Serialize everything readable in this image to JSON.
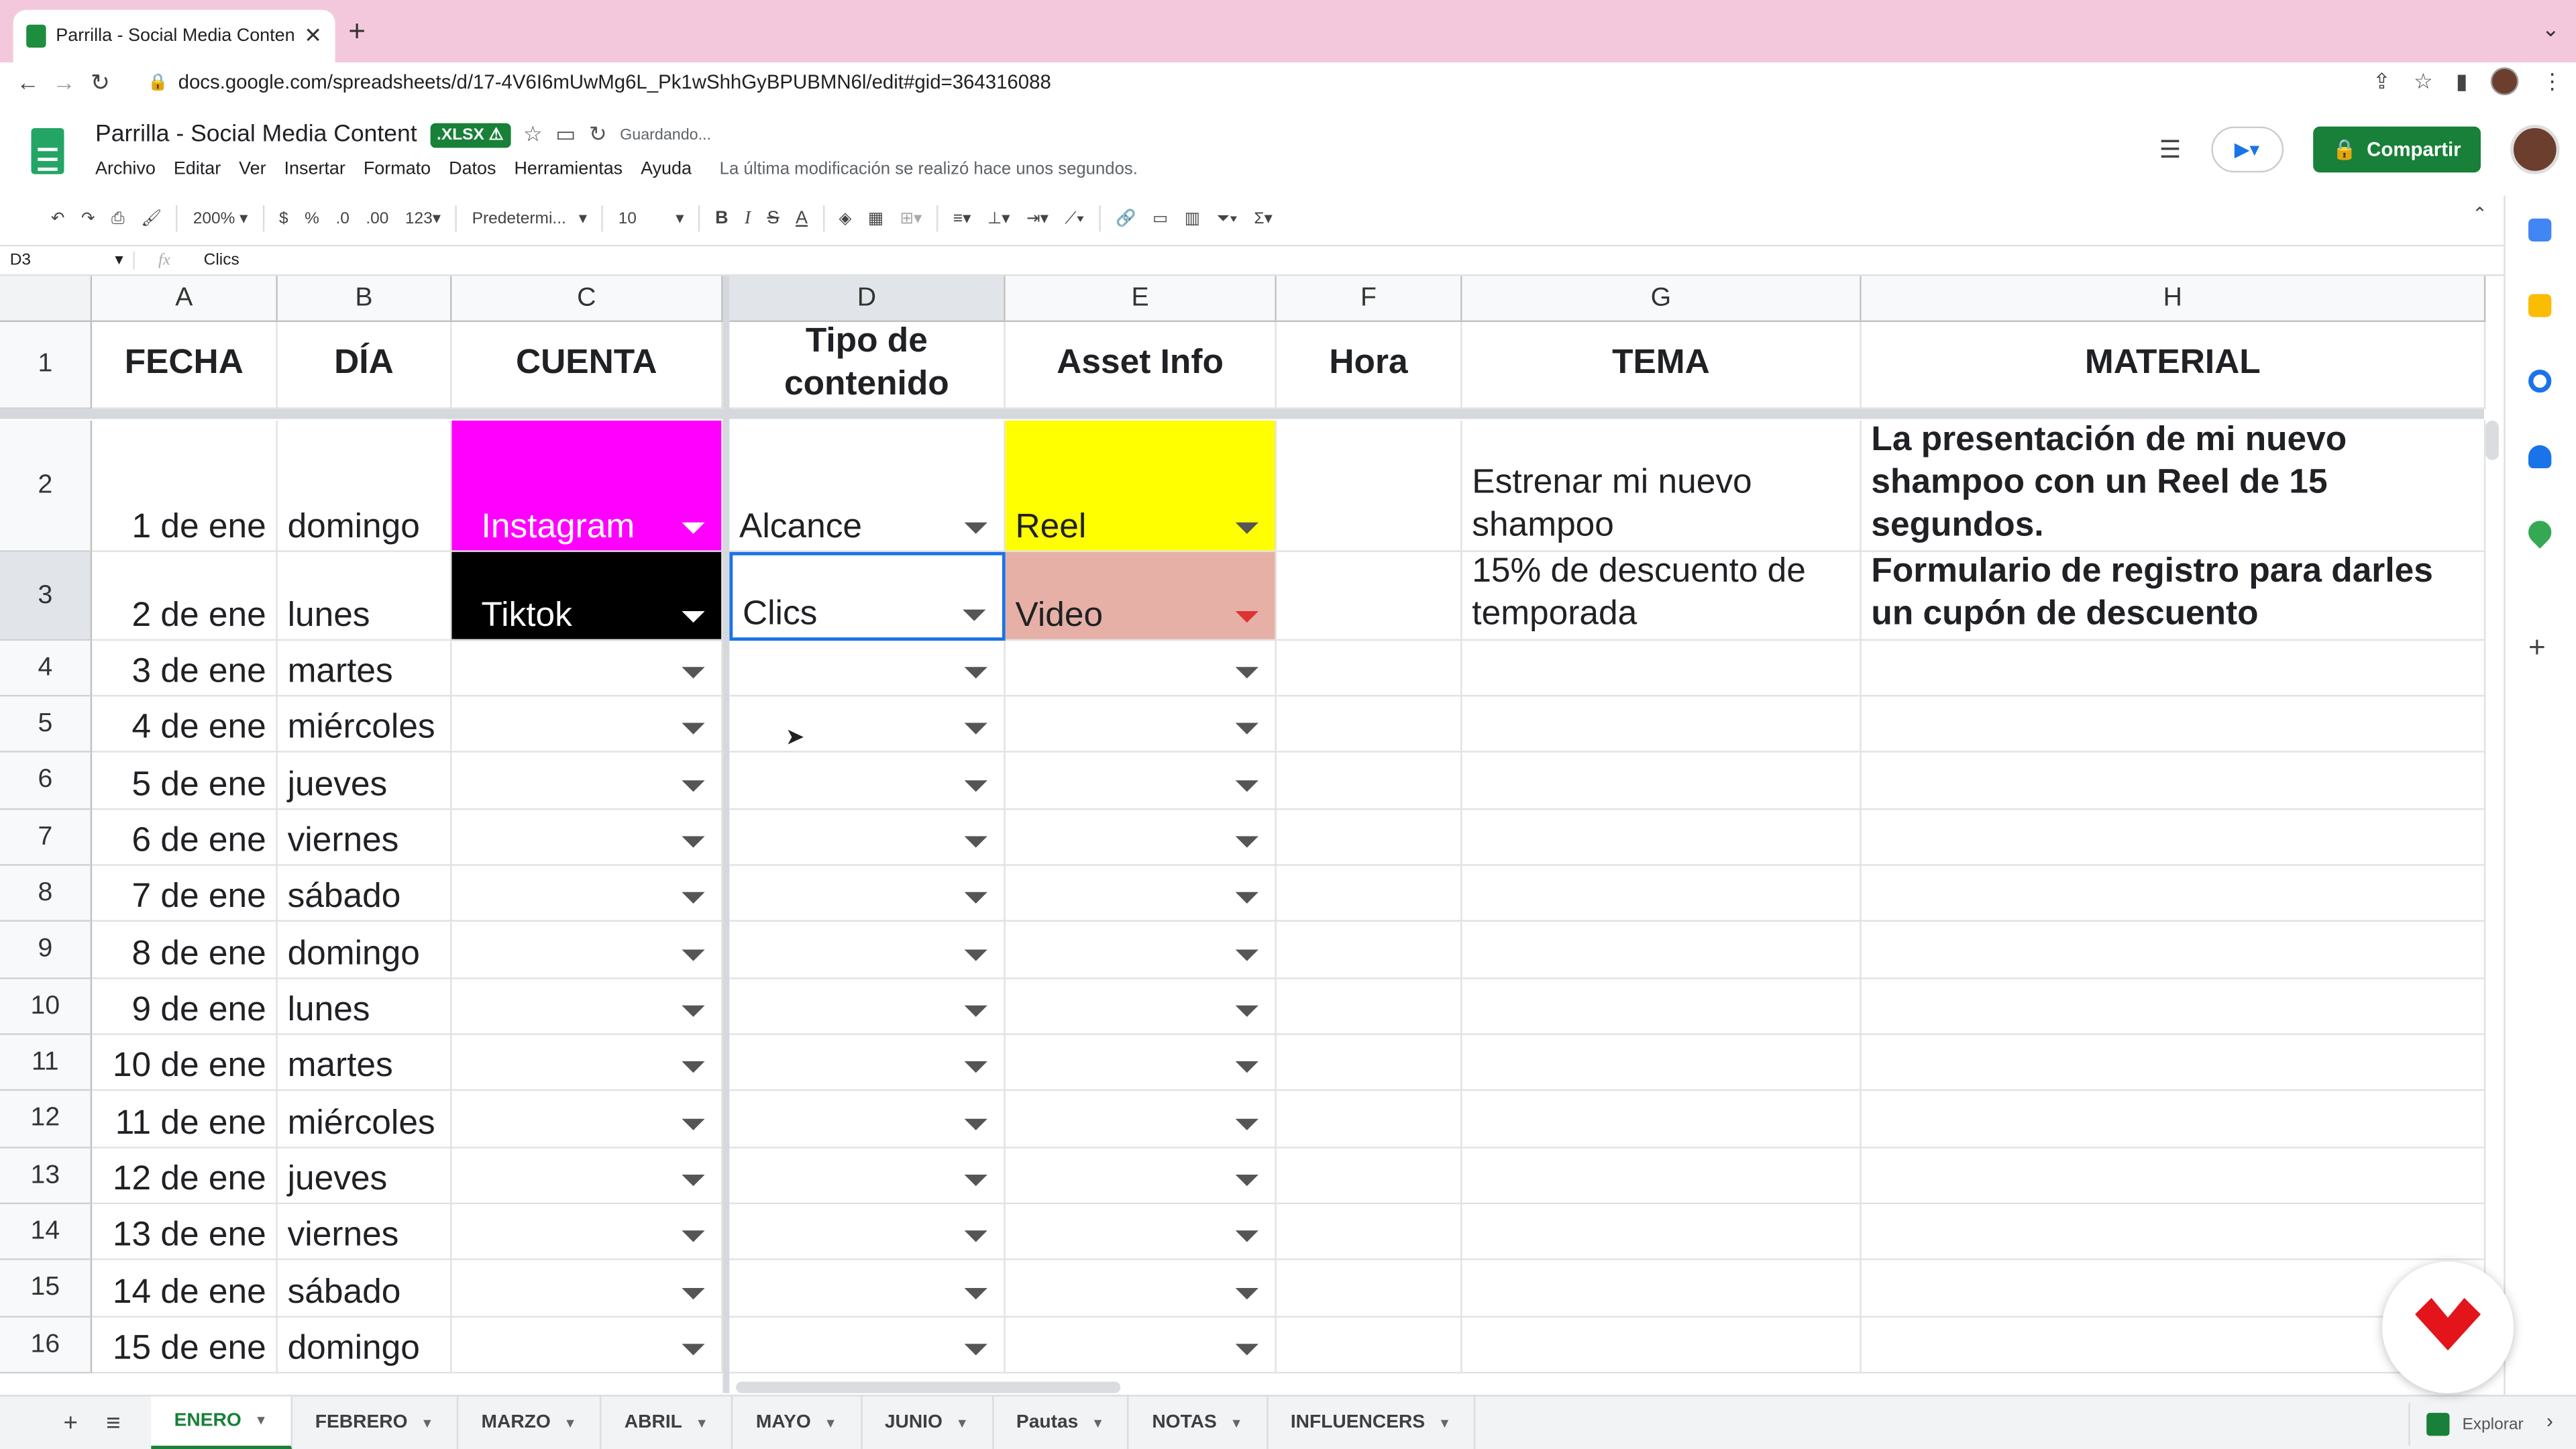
{
  "browser": {
    "tab_title": "Parrilla - Social Media Content",
    "url": "docs.google.com/spreadsheets/d/17-4V6I6mUwMg6L_Pk1wShhGyBPUBMN6l/edit#gid=364316088"
  },
  "doc": {
    "title": "Parrilla - Social Media Content",
    "format_badge": ".XLSX",
    "saving": "Guardando...",
    "menus": [
      "Archivo",
      "Editar",
      "Ver",
      "Insertar",
      "Formato",
      "Datos",
      "Herramientas",
      "Ayuda"
    ],
    "last_modified": "La última modificación se realizó hace unos segundos.",
    "share_label": "Compartir"
  },
  "toolbar": {
    "zoom": "200%",
    "currency": "$",
    "percent": "%",
    "dec_less": ".0",
    "dec_more": ".00",
    "more_formats": "123",
    "font": "Predetermi...",
    "font_size": "10",
    "bold": "B",
    "italic": "I",
    "strike": "S",
    "text_color": "A"
  },
  "formula_bar": {
    "cell_ref": "D3",
    "fx": "fx",
    "value": "Clics"
  },
  "columns": [
    "A",
    "B",
    "C",
    "D",
    "E",
    "F",
    "G",
    "H"
  ],
  "header_row": [
    "FECHA",
    "DÍA",
    "CUENTA",
    "Tipo de contenido",
    "Asset Info",
    "Hora",
    "TEMA",
    "MATERIAL"
  ],
  "rows": [
    {
      "n": "2",
      "fecha": "1 de ene",
      "dia": "domingo",
      "cuenta": "Instagram",
      "tipo": "Alcance",
      "asset": "Reel",
      "hora": "",
      "tema": "Estrenar mi nuevo shampoo",
      "material": "La presentación de mi nuevo shampoo con un Reel de 15 segundos."
    },
    {
      "n": "3",
      "fecha": "2 de ene",
      "dia": "lunes",
      "cuenta": "Tiktok",
      "tipo": "Clics",
      "asset": "Video",
      "hora": "",
      "tema": "15% de descuento de temporada",
      "material": "Formulario de registro para darles un cupón de descuento"
    },
    {
      "n": "4",
      "fecha": "3 de ene",
      "dia": "martes"
    },
    {
      "n": "5",
      "fecha": "4 de ene",
      "dia": "miércoles"
    },
    {
      "n": "6",
      "fecha": "5 de ene",
      "dia": "jueves"
    },
    {
      "n": "7",
      "fecha": "6 de ene",
      "dia": "viernes"
    },
    {
      "n": "8",
      "fecha": "7 de ene",
      "dia": "sábado"
    },
    {
      "n": "9",
      "fecha": "8 de ene",
      "dia": "domingo"
    },
    {
      "n": "10",
      "fecha": "9 de ene",
      "dia": "lunes"
    },
    {
      "n": "11",
      "fecha": "10 de ene",
      "dia": "martes"
    },
    {
      "n": "12",
      "fecha": "11 de ene",
      "dia": "miércoles"
    },
    {
      "n": "13",
      "fecha": "12 de ene",
      "dia": "jueves"
    },
    {
      "n": "14",
      "fecha": "13 de ene",
      "dia": "viernes"
    },
    {
      "n": "15",
      "fecha": "14 de ene",
      "dia": "sábado"
    },
    {
      "n": "16",
      "fecha": "15 de ene",
      "dia": "domingo"
    }
  ],
  "colors": {
    "instagram": "#ff00ff",
    "tiktok": "#000000",
    "reel": "#ffff00",
    "video": "#e6b0a6",
    "brand_green": "#188038"
  },
  "sheet_tabs": [
    "ENERO",
    "FEBRERO",
    "MARZO",
    "ABRIL",
    "MAYO",
    "JUNIO",
    "Pautas",
    "NOTAS",
    "INFLUENCERS"
  ],
  "active_sheet": "ENERO",
  "explore_label": "Explorar"
}
